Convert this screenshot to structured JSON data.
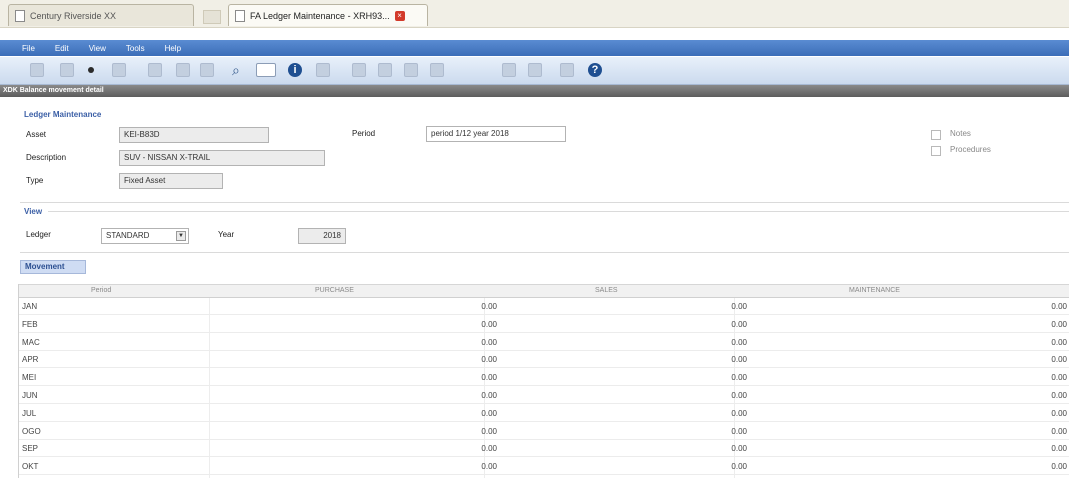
{
  "browser": {
    "tab_inactive": "Century Riverside XX",
    "tab_active": "FA Ledger Maintenance - XRH93..."
  },
  "menubar": [
    "File",
    "Edit",
    "View",
    "Tools",
    "Help"
  ],
  "titlebar": "XDK Balance movement detail",
  "form": {
    "section_title": "Ledger Maintenance",
    "asset_label": "Asset",
    "asset_value": "KEI-B83D",
    "period_label": "Period",
    "period_value": "period 1/12 year 2018",
    "description_label": "Description",
    "description_value": "SUV - NISSAN X-TRAIL",
    "type_label": "Type",
    "type_value": "Fixed Asset",
    "notes_label": "Notes",
    "procedures_label": "Procedures"
  },
  "view": {
    "section_title": "View",
    "ledger_label": "Ledger",
    "ledger_value": "STANDARD",
    "year_label": "Year",
    "year_value": "2018"
  },
  "grid": {
    "tab_label": "Movement",
    "columns": [
      "Period",
      "PURCHASE",
      "SALES",
      "MAINTENANCE"
    ],
    "rows": [
      {
        "period": "JAN",
        "purchase": "0.00",
        "sales": "0.00",
        "maintenance": "0.00"
      },
      {
        "period": "FEB",
        "purchase": "0.00",
        "sales": "0.00",
        "maintenance": "0.00"
      },
      {
        "period": "MAC",
        "purchase": "0.00",
        "sales": "0.00",
        "maintenance": "0.00"
      },
      {
        "period": "APR",
        "purchase": "0.00",
        "sales": "0.00",
        "maintenance": "0.00"
      },
      {
        "period": "MEI",
        "purchase": "0.00",
        "sales": "0.00",
        "maintenance": "0.00"
      },
      {
        "period": "JUN",
        "purchase": "0.00",
        "sales": "0.00",
        "maintenance": "0.00"
      },
      {
        "period": "JUL",
        "purchase": "0.00",
        "sales": "0.00",
        "maintenance": "0.00"
      },
      {
        "period": "OGO",
        "purchase": "0.00",
        "sales": "0.00",
        "maintenance": "0.00"
      },
      {
        "period": "SEP",
        "purchase": "0.00",
        "sales": "0.00",
        "maintenance": "0.00"
      },
      {
        "period": "OKT",
        "purchase": "0.00",
        "sales": "0.00",
        "maintenance": "0.00"
      }
    ]
  }
}
